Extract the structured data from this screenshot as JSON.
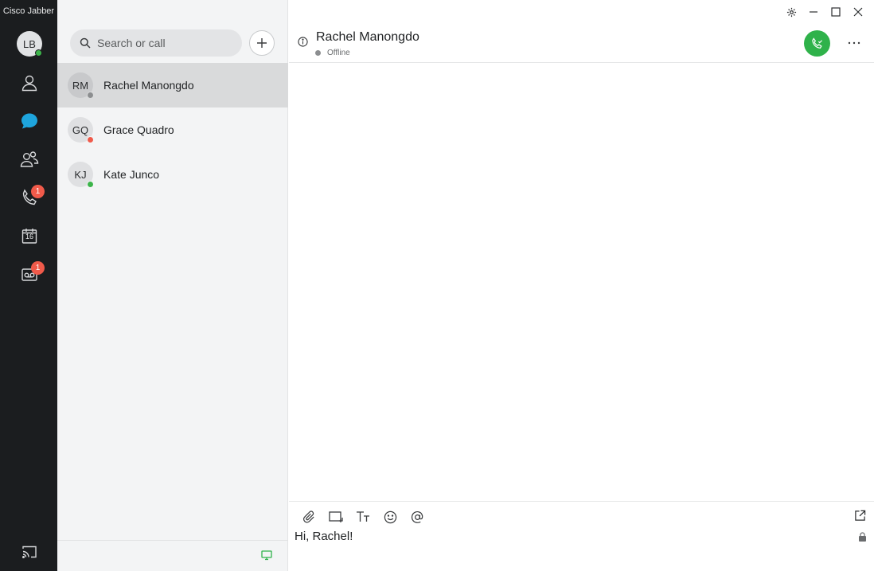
{
  "app": {
    "title": "Cisco Jabber"
  },
  "user": {
    "initials": "LB",
    "status_color": "#3cb44a"
  },
  "rail": {
    "items": [
      {
        "name": "contacts",
        "icon": "person-icon"
      },
      {
        "name": "chats",
        "icon": "chat-bubble-icon",
        "active": true,
        "accent": "#1ea5dd"
      },
      {
        "name": "meetings",
        "icon": "people-icon"
      },
      {
        "name": "calls",
        "icon": "phone-icon",
        "badge": "1"
      },
      {
        "name": "calendar",
        "icon": "calendar-icon",
        "day": "16"
      },
      {
        "name": "voicemail",
        "icon": "voicemail-icon",
        "badge": "1"
      }
    ],
    "bottom_icon": "cast-icon"
  },
  "search": {
    "placeholder": "Search or call"
  },
  "contacts": [
    {
      "initials": "RM",
      "name": "Rachel Manongdo",
      "status_color": "#8c8e90",
      "selected": true
    },
    {
      "initials": "GQ",
      "name": "Grace Quadro",
      "status_color": "#f05a4a"
    },
    {
      "initials": "KJ",
      "name": "Kate Junco",
      "status_color": "#3cb44a"
    }
  ],
  "chat": {
    "name": "Rachel Manongdo",
    "presence": "Offline",
    "draft": "Hi, Rachel!"
  },
  "colors": {
    "call_green": "#2fb24a",
    "badge_red": "#f05a4a",
    "accent_blue": "#1ea5dd"
  }
}
